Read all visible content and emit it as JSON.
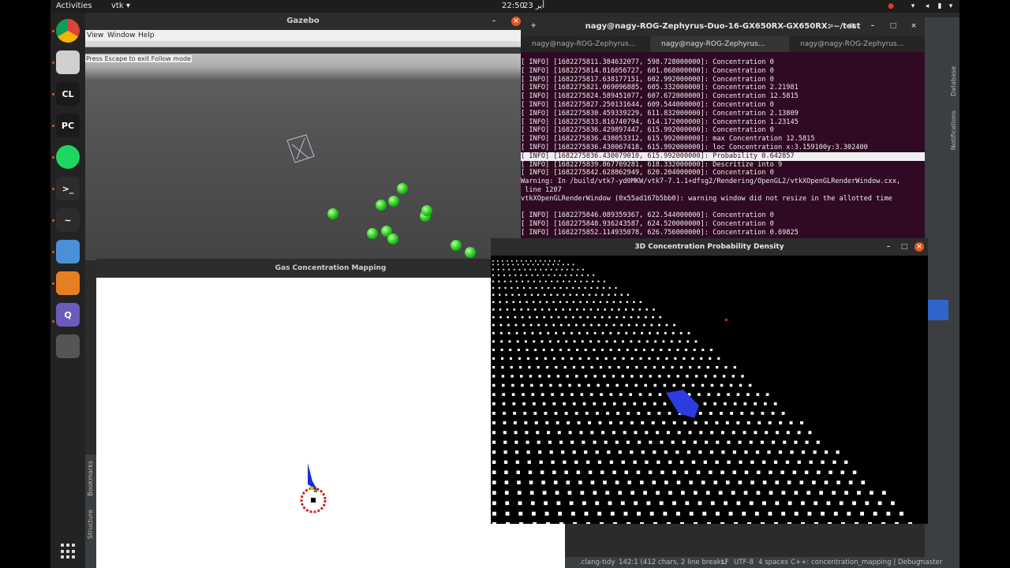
{
  "topbar": {
    "activities": "Activities",
    "app_menu": "vtk",
    "clock_time": "22:50",
    "clock_date": "23 أبر"
  },
  "dock": {
    "items": [
      {
        "name": "chrome-icon",
        "glyph": "",
        "color": "#ffffff"
      },
      {
        "name": "files-icon",
        "glyph": "",
        "color": "#d0d0d0"
      },
      {
        "name": "clion-icon",
        "glyph": "CL",
        "color": "#1a1a1a"
      },
      {
        "name": "pycharm-icon",
        "glyph": "PC",
        "color": "#1a1a1a"
      },
      {
        "name": "spotify-icon",
        "glyph": "",
        "color": "#1ed760"
      },
      {
        "name": "terminal-icon",
        "glyph": ">_",
        "color": "#2c2c2c"
      },
      {
        "name": "system-monitor-icon",
        "glyph": "~",
        "color": "#2c2c2c"
      },
      {
        "name": "image-viewer-icon",
        "glyph": "",
        "color": "#4a90d9"
      },
      {
        "name": "layers-app-icon",
        "glyph": "",
        "color": "#e67e22"
      },
      {
        "name": "qt-app-icon",
        "glyph": "Q",
        "color": "#6b5bbd"
      },
      {
        "name": "vtk-window-icon",
        "glyph": "",
        "color": "#555555"
      }
    ]
  },
  "gazebo": {
    "title": "Gazebo",
    "menu": [
      "View",
      "Window",
      "Help"
    ],
    "overlay_note": "Press Escape to exit Follow mode"
  },
  "gas_window": {
    "title": "Gas Concentration Mapping"
  },
  "ide_left": {
    "bookmarks": "Bookmarks",
    "structure": "Structure"
  },
  "terminal": {
    "title": "nagy@nagy-ROG-Zephyrus-Duo-16-GX650RX-GX650RX: ~/test",
    "tabs": [
      "nagy@nagy-ROG-Zephyrus...",
      "nagy@nagy-ROG-Zephyrus...",
      "nagy@nagy-ROG-Zephyrus..."
    ],
    "lines": [
      "[ INFO] [1682275811.384632077, 598.728000000]: Concentration 0",
      "[ INFO] [1682275814.816056727, 601.068000000]: Concentration 0",
      "[ INFO] [1682275817.638177151, 602.992000000]: Concentration 0",
      "[ INFO] [1682275821.069096885, 605.332000000]: Concentration 2.21981",
      "[ INFO] [1682275824.589451077, 607.672000000]: Concentration 12.5815",
      "[ INFO] [1682275827.250131644, 609.544000000]: Concentration 0",
      "[ INFO] [1682275830.459339229, 611.832000000]: Concentration 2.13809",
      "[ INFO] [1682275833.816740794, 614.172000000]: Concentration 1.23145",
      "[ INFO] [1682275836.429897447, 615.992000000]: Concentration 0",
      "[ INFO] [1682275836.430053312, 615.992000000]: max Concentration 12.5815",
      "[ INFO] [1682275836.430067418, 615.992000000]: loc Concentration x:3.159100y:3.302400",
      "[ INFO] [1682275836.430079010, 615.992000000]: Probability 0.642857",
      "[ INFO] [1682275839.867709281, 618.332000000]: Descritize into 9",
      "[ INFO] [1682275842.628862949, 620.204000000]: Concentration 0",
      "Warning: In /build/vtk7-yd0MKW/vtk7-7.1.1+dfsg2/Rendering/OpenGL2/vtkXOpenGLRenderWindow.cxx,",
      " line 1207",
      "vtkXOpenGLRenderWindow (0x55ad167b5bb0): warning window did not resize in the allotted time",
      "",
      "[ INFO] [1682275846.089359367, 622.544000000]: Concentration 0",
      "[ INFO] [1682275848.936243587, 624.520000000]: Concentration 0",
      "[ INFO] [1682275852.114935078, 626.756000000]: Concentration 0.69825"
    ],
    "highlight_index": 11
  },
  "vtk_window": {
    "title": "3D Concentration Probability Density",
    "min": "–",
    "max": "□",
    "close": "×"
  },
  "ide_right": {
    "database": "Database",
    "notifications": "Notifications"
  },
  "ide_status": {
    "items": [
      ".clang-tidy",
      "142:1 (412 chars, 2 line breaks)",
      "LF",
      "UTF-8",
      "4 spaces",
      "C++: concentration_mapping | Debug",
      "master"
    ]
  }
}
